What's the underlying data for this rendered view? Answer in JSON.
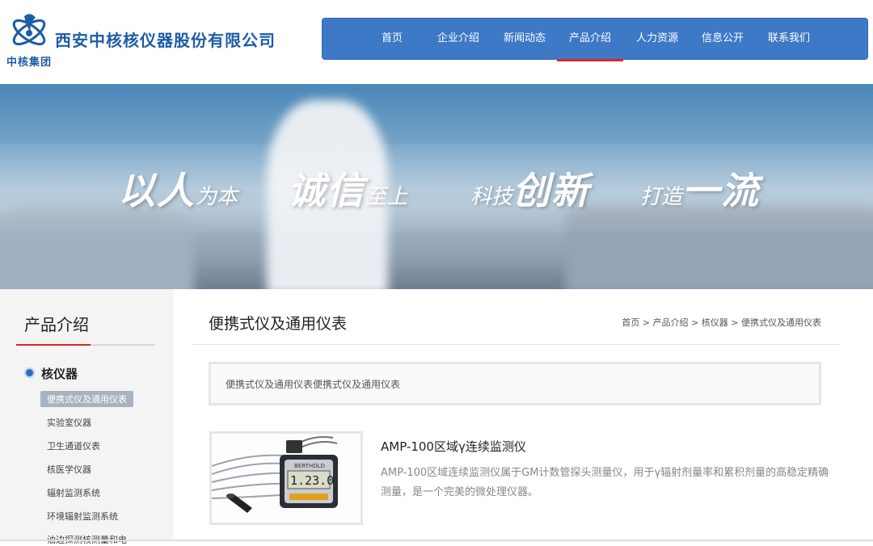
{
  "logo": {
    "company_name": "西安中核核仪器股份有限公司",
    "group_name": "中核集团"
  },
  "nav": {
    "items": [
      "首页",
      "企业介绍",
      "新闻动态",
      "产品介绍",
      "人力资源",
      "信息公开",
      "联系我们"
    ],
    "active": "产品介绍"
  },
  "banner": {
    "slogans": [
      {
        "big": "以人",
        "small": "为本"
      },
      {
        "big": "诚信",
        "small": "至上"
      },
      {
        "small": "科技",
        "big": "创新"
      },
      {
        "small": "打造",
        "big": "一流"
      }
    ]
  },
  "sidebar": {
    "title": "产品介绍",
    "category": "核仪器",
    "items": [
      "便携式仪及通用仪表",
      "实验室仪器",
      "卫生通道仪表",
      "核医学仪器",
      "辐射监测系统",
      "环境辐射监测系统",
      "油边探测核测量和电"
    ]
  },
  "main": {
    "title": "便携式仪及通用仪表",
    "breadcrumb": [
      "首页",
      "产品介绍",
      "核仪器",
      "便携式仪及通用仪表"
    ],
    "breadcrumb_sep": ">",
    "description": "便携式仪及通用仪表便携式仪及通用仪表",
    "product": {
      "name": "AMP-100区域γ连续监测仪",
      "description": "AMP-100区域连续监测仪属于GM计数管探头测量仪，用于γ辐射剂量率和累积剂量的高稳定精确测量，是一个完美的微处理仪器。",
      "device_brand": "BERTHOLD",
      "device_reading": "1.23.0"
    }
  },
  "colors": {
    "nav_bg": "#3d79c7",
    "accent_red": "#d9251d",
    "brand_blue": "#1d5ca8"
  }
}
